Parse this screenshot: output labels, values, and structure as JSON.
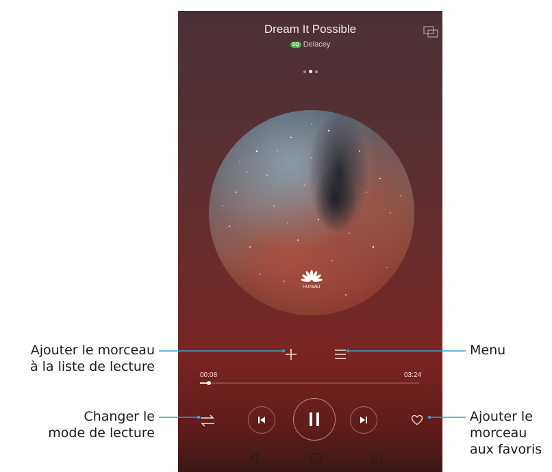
{
  "player": {
    "song_title": "Dream It Possible",
    "sq_badge": "SQ",
    "artist": "Delacey",
    "album_logo_text": "HUAWEI",
    "page_indicator": {
      "count": 3,
      "active_index": 1
    },
    "elapsed": "00:08",
    "duration": "03:24",
    "progress_fraction": 0.04,
    "state": "playing"
  },
  "icons": {
    "cast": "cast-icon",
    "add": "plus-icon",
    "menu": "list-icon",
    "mode": "shuffle-icon",
    "prev": "skip-previous-icon",
    "play": "pause-icon",
    "next": "skip-next-icon",
    "fav": "heart-icon",
    "nav_back": "triangle-back-icon",
    "nav_home": "circle-home-icon",
    "nav_recent": "square-recents-icon"
  },
  "callouts": {
    "add": [
      "Ajouter le morceau",
      "à la liste de lecture"
    ],
    "menu": [
      "Menu"
    ],
    "mode": [
      "Changer le",
      "mode de lecture"
    ],
    "fav": [
      "Ajouter le",
      "morceau",
      "aux favoris"
    ]
  },
  "colors": {
    "callout_line": "#2aa8c8",
    "sq_badge": "#46b43c"
  }
}
